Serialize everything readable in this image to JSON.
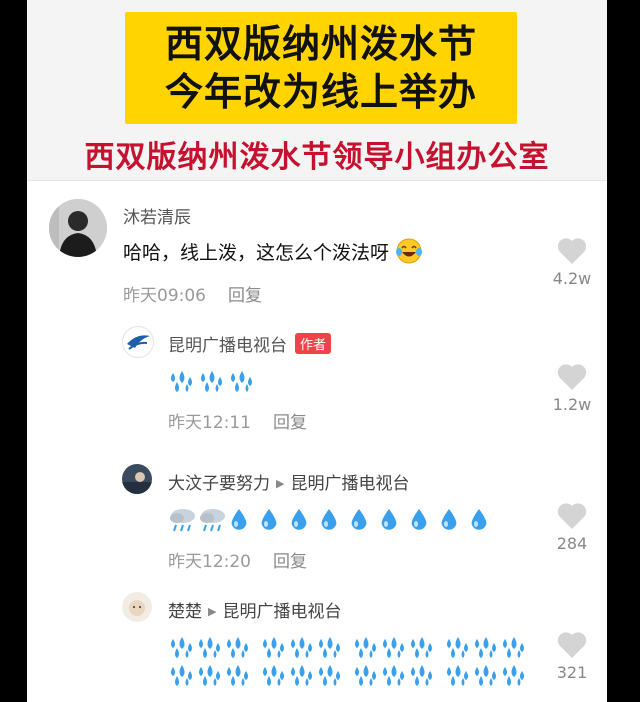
{
  "banner": {
    "title_line1": "西双版纳州泼水节",
    "title_line2": "今年改为线上举办",
    "subtitle": "西双版纳州泼水节领导小组办公室"
  },
  "comments": [
    {
      "author": "沐若清辰",
      "text": "哈哈，线上泼，这怎么个泼法呀",
      "emoji": "laughing-crying-emoji",
      "time": "昨天09:06",
      "reply_label": "回复",
      "likes": "4.2w"
    },
    {
      "author": "昆明广播电视台",
      "author_badge": "作者",
      "drops": "splash-emoji x3",
      "time": "昨天12:11",
      "reply_label": "回复",
      "likes": "1.2w"
    },
    {
      "author": "大汶子要努力",
      "reply_to": "昆明广播电视台",
      "drops": "rain-cloud x2, droplet x9",
      "time": "昨天12:20",
      "reply_label": "回复",
      "likes": "284"
    },
    {
      "author": "楚楚",
      "reply_to": "昆明广播电视台",
      "drops": "splash-emoji rows",
      "likes": "321"
    }
  ],
  "colors": {
    "banner_yellow": "#ffd400",
    "subtitle_red": "#c4122f",
    "badge_red": "#f0424a",
    "drop_blue": "#3aa0ec"
  }
}
